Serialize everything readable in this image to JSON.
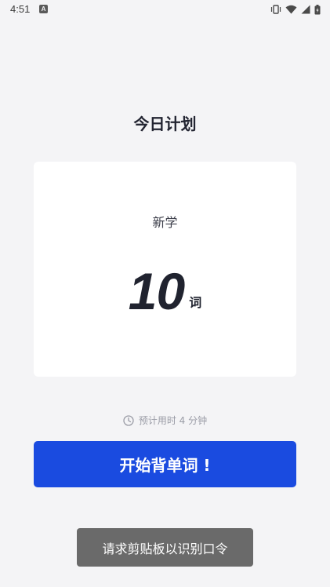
{
  "status_bar": {
    "time": "4:51",
    "notification_letter": "A",
    "icons": [
      "vibrate-icon",
      "wifi-icon",
      "signal-icon",
      "battery-icon"
    ]
  },
  "plan": {
    "title": "今日计划",
    "card_label": "新学",
    "count": "10",
    "unit": "词"
  },
  "estimate": {
    "text": "预计用时 4 分钟",
    "icon": "clock-icon"
  },
  "start_button": {
    "label": "开始背单词 !"
  },
  "toast": {
    "text": "请求剪贴板以识别口令"
  },
  "colors": {
    "background": "#f4f4f6",
    "accent": "#1a4be0",
    "toast": "#6a6a6a"
  }
}
